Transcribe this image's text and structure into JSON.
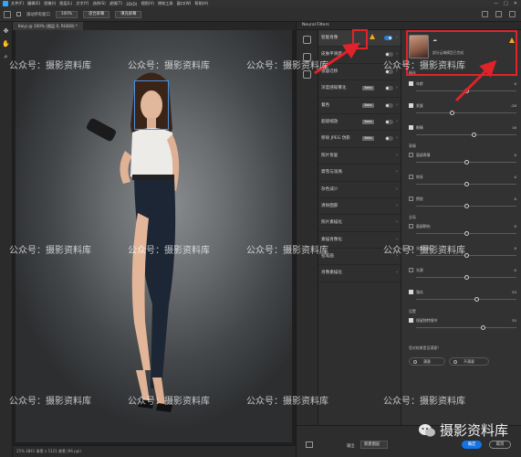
{
  "menubar": {
    "items": [
      "文件(F)",
      "编辑(E)",
      "图像(I)",
      "图层(L)",
      "文字(Y)",
      "选择(S)",
      "滤镜(T)",
      "3D(D)",
      "视图(V)",
      "增效工具",
      "窗口(W)",
      "帮助(H)"
    ]
  },
  "options_bar": {
    "scroll_all_label": "滚动所有窗口",
    "zoom_value": "100%",
    "fit_screen_label": "适合屏幕",
    "fill_screen_label": "填充屏幕"
  },
  "toolbar": {
    "icons": [
      "move-icon",
      "hand-icon",
      "zoom-icon"
    ]
  },
  "document": {
    "tab_label": "Kaiyi @ 100% (图层 0, RGB/8) *"
  },
  "status": {
    "text": "25%    3841 像素 x 5121 像素 (96 ppi)"
  },
  "neural_filters": {
    "title": "Neural Filters",
    "filters": [
      {
        "name": "智能肖像",
        "toggle": "on",
        "warning": true
      },
      {
        "name": "皮肤平滑度",
        "toggle": "off",
        "warning": false
      },
      {
        "name": "妆容迁移",
        "toggle": "off",
        "warning": false
      },
      {
        "name": "深度感知雾化",
        "beta": "Beta",
        "toggle": "off",
        "warning": false
      },
      {
        "name": "着色",
        "beta": "Beta",
        "toggle": "off",
        "warning": false
      },
      {
        "name": "超级缩放",
        "beta": "Beta",
        "toggle": "off",
        "warning": false
      },
      {
        "name": "移除 JPEG 伪影",
        "beta": "Beta",
        "toggle": "off",
        "warning": false
      },
      {
        "name": "照片恢复",
        "warning": false
      },
      {
        "name": "骤雪与泼溅",
        "warning": false
      },
      {
        "name": "杂色减少",
        "warning": false
      },
      {
        "name": "清除面部",
        "warning": false
      },
      {
        "name": "照片素描化",
        "warning": false
      },
      {
        "name": "素描肖像化",
        "warning": false
      },
      {
        "name": "铅笔画",
        "warning": false
      },
      {
        "name": "肖像素描化",
        "warning": false
      }
    ],
    "preview_note": "部分云端模型已完成",
    "sections": {
      "featured": "精选",
      "expressions": "表情",
      "global": "全局",
      "settings": "设置"
    },
    "sliders": [
      {
        "label": "年龄",
        "value": "0",
        "checked": true,
        "pos": 0.5
      },
      {
        "label": "发量",
        "value": "-28",
        "checked": true,
        "pos": 0.36
      },
      {
        "label": "眼睛",
        "value": "16",
        "checked": true,
        "pos": 0.58
      },
      {
        "label": "面部表情",
        "value": "0",
        "checked": false,
        "pos": 0.5
      },
      {
        "label": "惊讶",
        "value": "0",
        "checked": false,
        "pos": 0.5
      },
      {
        "label": "愤怒",
        "value": "0",
        "checked": false,
        "pos": 0.5
      },
      {
        "label": "面部朝向",
        "value": "0",
        "checked": false,
        "pos": 0.5
      },
      {
        "label": "光线方向",
        "value": "0",
        "checked": false,
        "pos": 0.5
      },
      {
        "label": "光源",
        "value": "0",
        "checked": false,
        "pos": 0.5
      },
      {
        "label": "强化",
        "value": "20",
        "checked": true,
        "pos": 0.6
      },
      {
        "label": "保留独特细节",
        "value": "35",
        "checked": true,
        "pos": 0.67
      }
    ],
    "feedback_question": "您对结果是否满意？",
    "yes_label": "满意",
    "no_label": "不满意",
    "output_label": "输出",
    "output_value": "新建图层",
    "ok_label": "确定",
    "cancel_label": "取消"
  },
  "watermarks": [
    "公众号：摄影资料库",
    "公众号：摄影资料库",
    "公众号：摄影资料库",
    "公众号：摄影资料库",
    "公众号：摄影资料库",
    "公众号：摄影资料库",
    "公众号：摄影资料库",
    "公众号：摄影资料库",
    "公众号：摄影资料库",
    "公众号：摄影资料库",
    "公众号：摄影资料库",
    "公众号：摄影资料库"
  ],
  "brand": {
    "name": "摄影资料库"
  },
  "colors": {
    "accent_blue": "#1473e6",
    "warning": "#f5a623",
    "annotation_red": "#e0232a"
  }
}
